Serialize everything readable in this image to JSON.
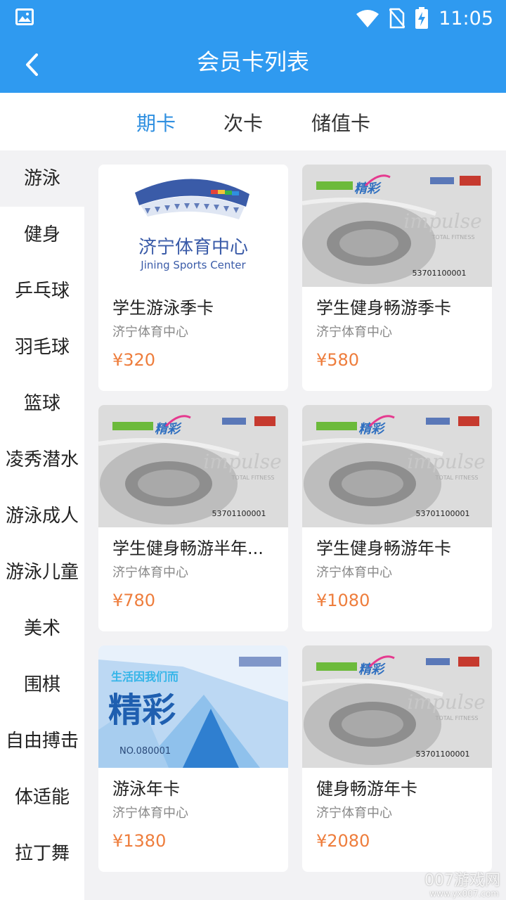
{
  "status": {
    "time": "11:05",
    "icons": [
      "gallery-icon",
      "wifi-icon",
      "no-sim-icon",
      "battery-charging-icon"
    ]
  },
  "header": {
    "title": "会员卡列表",
    "back_icon": "back-arrow-icon"
  },
  "tabs": [
    {
      "label": "期卡",
      "active": true
    },
    {
      "label": "次卡",
      "active": false
    },
    {
      "label": "储值卡",
      "active": false
    }
  ],
  "sidebar": {
    "items": [
      {
        "label": "游泳",
        "active": true
      },
      {
        "label": "健身"
      },
      {
        "label": "乒乓球"
      },
      {
        "label": "羽毛球"
      },
      {
        "label": "篮球"
      },
      {
        "label": "凌秀潜水"
      },
      {
        "label": "游泳成人"
      },
      {
        "label": "游泳儿童"
      },
      {
        "label": "美术"
      },
      {
        "label": "围棋"
      },
      {
        "label": "自由搏击"
      },
      {
        "label": "体适能"
      },
      {
        "label": "拉丁舞"
      }
    ]
  },
  "cards": [
    {
      "name": "学生游泳季卡",
      "venue": "济宁体育中心",
      "price": "¥320",
      "image": "logo",
      "logo_text": "济宁体育中心",
      "logo_sub": "Jining Sports Center"
    },
    {
      "name": "学生健身畅游季卡",
      "venue": "济宁体育中心",
      "price": "¥580",
      "image": "stadium",
      "card_no": "53701100001"
    },
    {
      "name": "学生健身畅游半年...",
      "venue": "济宁体育中心",
      "price": "¥780",
      "image": "stadium",
      "card_no": "53701100001"
    },
    {
      "name": "学生健身畅游年卡",
      "venue": "济宁体育中心",
      "price": "¥1080",
      "image": "stadium",
      "card_no": "53701100001"
    },
    {
      "name": "游泳年卡",
      "venue": "济宁体育中心",
      "price": "¥1380",
      "image": "blue",
      "slogan": "生活因我们而",
      "big": "精彩",
      "card_no": "NO.080001"
    },
    {
      "name": "健身畅游年卡",
      "venue": "济宁体育中心",
      "price": "¥2080",
      "image": "stadium",
      "card_no": "53701100001"
    }
  ],
  "card_art": {
    "brand_slogan": "精彩",
    "fitness_word": "impulse",
    "fitness_sub": "TOTAL FITNESS"
  },
  "watermark": {
    "main": "007游戏网",
    "sub": "www.yx007.com"
  },
  "colors": {
    "primary": "#2f9af0",
    "tab_active": "#2f8fe0",
    "price": "#ee7d3c"
  }
}
